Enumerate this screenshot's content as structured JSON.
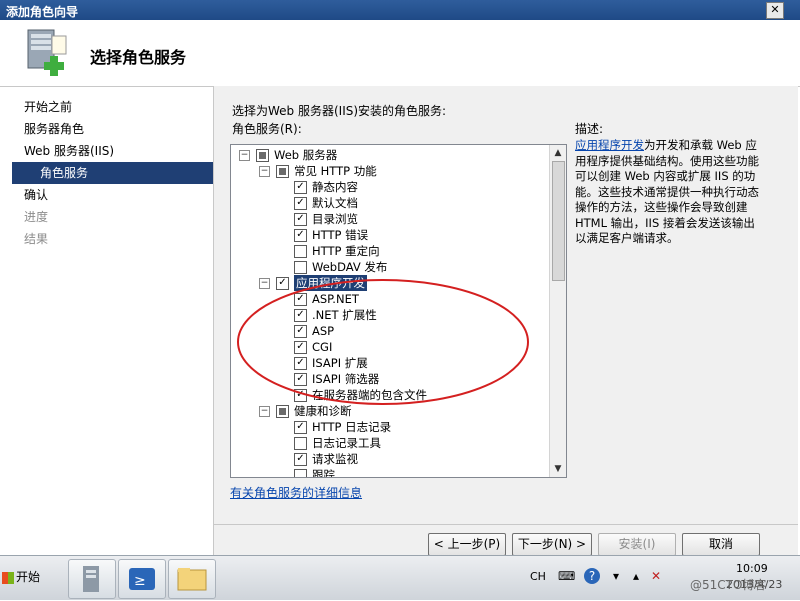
{
  "window": {
    "title": "添加角色向导",
    "close_glyph": "✕"
  },
  "header": {
    "title": "选择角色服务",
    "icon": "server-add-icon"
  },
  "nav": [
    {
      "label": "开始之前",
      "state": "normal"
    },
    {
      "label": "服务器角色",
      "state": "normal"
    },
    {
      "label": "Web 服务器(IIS)",
      "state": "normal"
    },
    {
      "label": "角色服务",
      "state": "selected"
    },
    {
      "label": "确认",
      "state": "normal"
    },
    {
      "label": "进度",
      "state": "disabled"
    },
    {
      "label": "结果",
      "state": "disabled"
    }
  ],
  "content": {
    "prompt": "选择为Web 服务器(IIS)安装的角色服务:",
    "roles_label": "角色服务(R):",
    "description_title": "描述:",
    "description_link": "应用程序开发",
    "description_text": "为开发和承载 Web 应用程序提供基础结构。使用这些功能可以创建 Web 内容或扩展 IIS 的功能。这些技术通常提供一种执行动态操作的方法，这些操作会导致创建 HTML 输出，IIS 接着会发送该输出以满足客户端请求。",
    "more_info_link": "有关角色服务的详细信息"
  },
  "tree": [
    {
      "level": 0,
      "toggle": "minus",
      "check": "partial",
      "label": "Web 服务器"
    },
    {
      "level": 1,
      "toggle": "minus",
      "check": "partial",
      "label": "常见 HTTP 功能"
    },
    {
      "level": 2,
      "toggle": "",
      "check": "checked",
      "label": "静态内容"
    },
    {
      "level": 2,
      "toggle": "",
      "check": "checked",
      "label": "默认文档"
    },
    {
      "level": 2,
      "toggle": "",
      "check": "checked",
      "label": "目录浏览"
    },
    {
      "level": 2,
      "toggle": "",
      "check": "checked",
      "label": "HTTP 错误"
    },
    {
      "level": 2,
      "toggle": "",
      "check": "unchecked",
      "label": "HTTP 重定向"
    },
    {
      "level": 2,
      "toggle": "",
      "check": "unchecked",
      "label": "WebDAV 发布"
    },
    {
      "level": 1,
      "toggle": "minus",
      "check": "checked",
      "label": "应用程序开发",
      "highlight": true
    },
    {
      "level": 2,
      "toggle": "",
      "check": "checked",
      "label": "ASP.NET"
    },
    {
      "level": 2,
      "toggle": "",
      "check": "checked",
      "label": ".NET 扩展性"
    },
    {
      "level": 2,
      "toggle": "",
      "check": "checked",
      "label": "ASP"
    },
    {
      "level": 2,
      "toggle": "",
      "check": "checked",
      "label": "CGI"
    },
    {
      "level": 2,
      "toggle": "",
      "check": "checked",
      "label": "ISAPI 扩展"
    },
    {
      "level": 2,
      "toggle": "",
      "check": "checked",
      "label": "ISAPI 筛选器"
    },
    {
      "level": 2,
      "toggle": "",
      "check": "checked",
      "label": "在服务器端的包含文件"
    },
    {
      "level": 1,
      "toggle": "minus",
      "check": "partial",
      "label": "健康和诊断"
    },
    {
      "level": 2,
      "toggle": "",
      "check": "checked",
      "label": "HTTP 日志记录"
    },
    {
      "level": 2,
      "toggle": "",
      "check": "unchecked",
      "label": "日志记录工具"
    },
    {
      "level": 2,
      "toggle": "",
      "check": "checked",
      "label": "请求监视"
    },
    {
      "level": 2,
      "toggle": "",
      "check": "unchecked",
      "label": "跟踪"
    }
  ],
  "buttons": {
    "prev": "< 上一步(P)",
    "next": "下一步(N) >",
    "install": "安装(I)",
    "cancel": "取消"
  },
  "taskbar": {
    "start": "开始",
    "lang": "CH",
    "time": "10:09",
    "date": "2013/4/23",
    "watermark": "@51CTO博客"
  },
  "colors": {
    "selection": "#1f3f74",
    "annotation_circle": "#d42020",
    "link": "#0645ad"
  }
}
